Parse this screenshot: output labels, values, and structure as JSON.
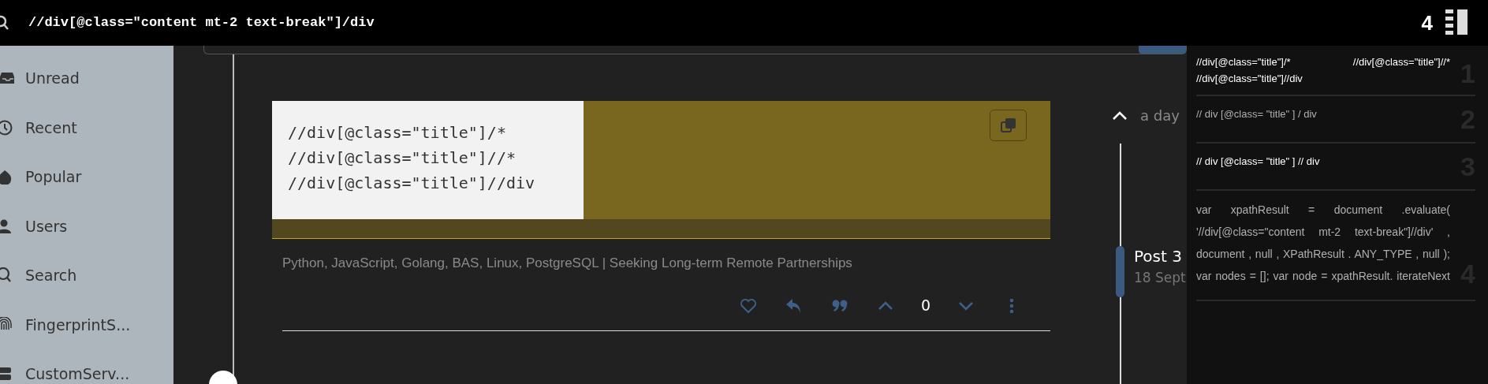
{
  "search_bar": {
    "value": "//div[@class=\"content mt-2 text-break\"]/div",
    "count": "4"
  },
  "sidebar": {
    "items": [
      {
        "label": "Unread"
      },
      {
        "label": "Recent"
      },
      {
        "label": "Popular"
      },
      {
        "label": "Users"
      },
      {
        "label": "Search"
      },
      {
        "label": "FingerprintS..."
      },
      {
        "label": "CustomServ..."
      }
    ]
  },
  "post": {
    "code_lines": [
      "//div[@class=\"title\"]/*",
      "//div[@class=\"title\"]//*",
      "//div[@class=\"title\"]//div"
    ],
    "signature": "Python, JavaScript, Golang, BAS, Linux, PostgreSQL | Seeking Long-term Remote Partnerships",
    "votes": "0"
  },
  "timeline": {
    "time": "a day",
    "post_label": "Post 3",
    "date": "18 Sept"
  },
  "results": [
    {
      "number": "1",
      "text": "//div[@class=\"title\"]/* //div[@class=\"title\"]//* //div[@class=\"title\"]//div",
      "highlighted": true
    },
    {
      "number": "2",
      "text": "// div [@class= \"title\" ] / div",
      "highlighted": false
    },
    {
      "number": "3",
      "text": "// div [@class= \"title\" ] // div",
      "highlighted": true
    },
    {
      "number": "4",
      "text": "var xpathResult = document .evaluate( '//div[@class=\"content mt-2 text-break\"]//div' , document , null , XPathResult . ANY_TYPE , null ); var nodes = []; var node = xpathResult. iterateNext",
      "highlighted": false
    }
  ]
}
